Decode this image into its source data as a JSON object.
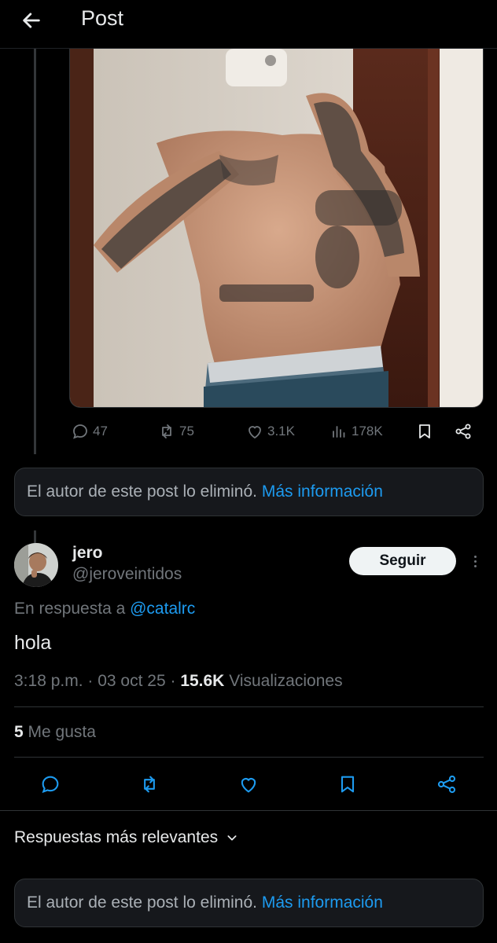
{
  "header": {
    "title": "Post"
  },
  "post": {
    "stats": {
      "replies": "47",
      "reposts": "75",
      "likes": "3.1K",
      "views": "178K"
    }
  },
  "deleted_notice": {
    "text": "El autor de este post lo eliminó.",
    "link": "Más información"
  },
  "reply": {
    "name": "jero",
    "handle": "@jeroveintidos",
    "follow_label": "Seguir",
    "reply_prefix": "En respuesta a",
    "reply_mention": "@catalrc",
    "text": "hola",
    "time": "3:18 p.m.",
    "date": "03 oct 25",
    "views_count": "15.6K",
    "views_label": "Visualizaciones",
    "likes_count": "5",
    "likes_label": "Me gusta"
  },
  "replies_section": {
    "sort_label": "Respuestas más relevantes"
  },
  "deleted_notice_2": {
    "text": "El autor de este post lo eliminó.",
    "link": "Más información"
  },
  "colors": {
    "accent": "#1d9bf0",
    "muted": "#71767b",
    "text": "#e7e9ea",
    "border": "#2f3336"
  }
}
